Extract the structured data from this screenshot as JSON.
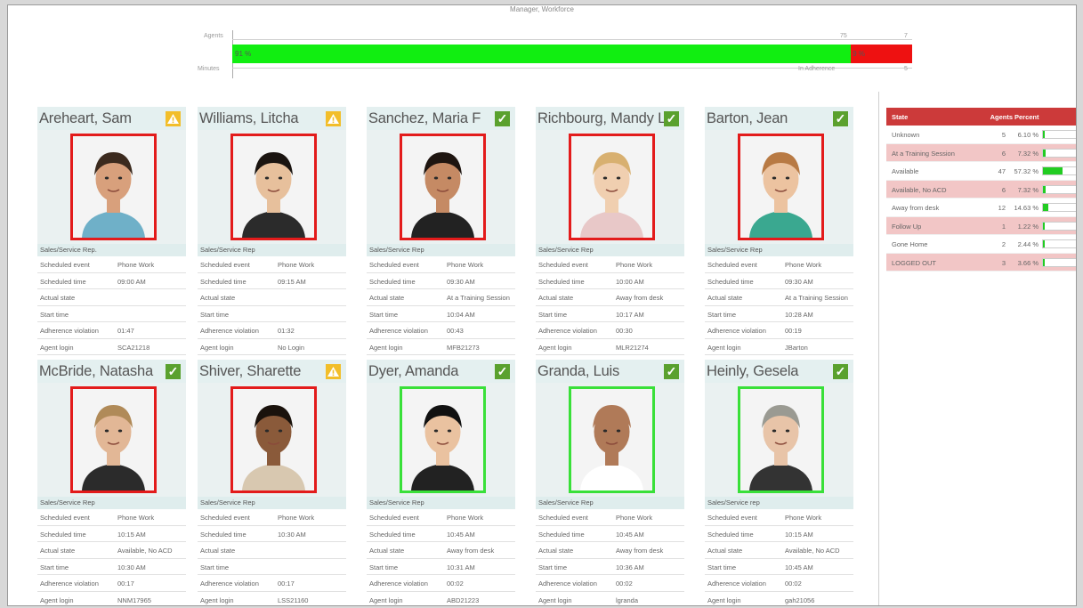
{
  "app": {
    "top_title": "Manager, Workforce"
  },
  "adherence": {
    "agents_label": "Agents",
    "minutes_label": "Minutes",
    "in_adherence_label": "In Adherence",
    "green_pct_label": "91 %",
    "red_pct_label": "9 %",
    "green_fraction": 0.91,
    "tick_75": "75",
    "tick_7": "7",
    "tick_5": "5"
  },
  "labels": {
    "scheduled_event": "Scheduled event",
    "scheduled_time": "Scheduled time",
    "actual_state": "Actual state",
    "start_time": "Start time",
    "adherence_violation": "Adherence violation",
    "agent_login": "Agent login"
  },
  "agents": [
    {
      "name": "Areheart, Sam",
      "status": "warning",
      "role": "Sales/Service Rep.",
      "scheduled_event": "Phone Work",
      "scheduled_time": "09:00 AM",
      "actual_state": "",
      "start_time": "",
      "adherence_violation": "01:47",
      "agent_login": "SCA21218",
      "frame": "red",
      "hair": "#3b2a1e",
      "skin": "#d8a07c",
      "shirt": "#6fb0c8"
    },
    {
      "name": "Williams, Litcha",
      "status": "warning",
      "role": "Sales/Service Rep",
      "scheduled_event": "Phone Work",
      "scheduled_time": "09:15 AM",
      "actual_state": "",
      "start_time": "",
      "adherence_violation": "01:32",
      "agent_login": "No Login",
      "frame": "red",
      "hair": "#1a1410",
      "skin": "#e7c09c",
      "shirt": "#2b2b2b"
    },
    {
      "name": "Sanchez, Maria F",
      "status": "ok",
      "role": "Sales/Service Rep",
      "scheduled_event": "Phone Work",
      "scheduled_time": "09:30 AM",
      "actual_state": "At a Training Session",
      "start_time": "10:04 AM",
      "adherence_violation": "00:43",
      "agent_login": "MFB21273",
      "frame": "red",
      "hair": "#1e1510",
      "skin": "#c58a64",
      "shirt": "#222222"
    },
    {
      "name": "Richbourg, Mandy L",
      "status": "ok",
      "role": "Sales/Service Rep",
      "scheduled_event": "Phone Work",
      "scheduled_time": "10:00 AM",
      "actual_state": "Away from desk",
      "start_time": "10:17 AM",
      "adherence_violation": "00:30",
      "agent_login": "MLR21274",
      "frame": "red",
      "hair": "#d8b070",
      "skin": "#f0cfb0",
      "shirt": "#e8c8c8"
    },
    {
      "name": "Barton, Jean",
      "status": "ok",
      "role": "Sales/Service Rep",
      "scheduled_event": "Phone Work",
      "scheduled_time": "09:30 AM",
      "actual_state": "At a Training Session",
      "start_time": "10:28 AM",
      "adherence_violation": "00:19",
      "agent_login": "JBarton",
      "frame": "red",
      "hair": "#b87a44",
      "skin": "#ecc3a0",
      "shirt": "#3aa890"
    },
    {
      "name": "McBride, Natasha",
      "status": "ok",
      "role": "Sales/Service Rep",
      "scheduled_event": "Phone Work",
      "scheduled_time": "10:15 AM",
      "actual_state": "Available, No ACD",
      "start_time": "10:30 AM",
      "adherence_violation": "00:17",
      "agent_login": "NNM17965",
      "frame": "red",
      "hair": "#b08a58",
      "skin": "#e2b796",
      "shirt": "#2b2b2b"
    },
    {
      "name": "Shiver, Sharette",
      "status": "warning",
      "role": "Sales/Service Rep",
      "scheduled_event": "Phone Work",
      "scheduled_time": "10:30 AM",
      "actual_state": "",
      "start_time": "",
      "adherence_violation": "00:17",
      "agent_login": "LSS21160",
      "frame": "red",
      "hair": "#1a120c",
      "skin": "#8a5a3a",
      "shirt": "#d8c8b0"
    },
    {
      "name": "Dyer, Amanda",
      "status": "ok",
      "role": "Sales/Service Rep",
      "scheduled_event": "Phone Work",
      "scheduled_time": "10:45 AM",
      "actual_state": "Away from desk",
      "start_time": "10:31 AM",
      "adherence_violation": "00:02",
      "agent_login": "ABD21223",
      "frame": "green",
      "hair": "#111111",
      "skin": "#eac2a0",
      "shirt": "#222222"
    },
    {
      "name": "Granda, Luis",
      "status": "ok",
      "role": "Sales/Service Rep",
      "scheduled_event": "Phone Work",
      "scheduled_time": "10:45 AM",
      "actual_state": "Away from desk",
      "start_time": "10:36 AM",
      "adherence_violation": "00:02",
      "agent_login": "lgranda",
      "frame": "green",
      "hair": "#b07a58",
      "skin": "#b07a58",
      "shirt": "#ffffff"
    },
    {
      "name": "Heinly, Gesela",
      "status": "ok",
      "role": "Sales/Service rep",
      "scheduled_event": "Phone Work",
      "scheduled_time": "10:15 AM",
      "actual_state": "Available, No ACD",
      "start_time": "10:45 AM",
      "adherence_violation": "00:02",
      "agent_login": "gah21056",
      "frame": "green",
      "hair": "#9a9a92",
      "skin": "#e8c4a8",
      "shirt": "#333333"
    }
  ],
  "state_table": {
    "headers": {
      "state": "State",
      "agents": "Agents",
      "percent": "Percent"
    },
    "rows": [
      {
        "state": "Unknown",
        "agents": "5",
        "percent": "6.10 %",
        "fraction": 0.061,
        "highlight": false
      },
      {
        "state": "At a Training Session",
        "agents": "6",
        "percent": "7.32 %",
        "fraction": 0.0732,
        "highlight": true
      },
      {
        "state": "Available",
        "agents": "47",
        "percent": "57.32 %",
        "fraction": 0.5732,
        "highlight": false
      },
      {
        "state": "Available, No ACD",
        "agents": "6",
        "percent": "7.32 %",
        "fraction": 0.0732,
        "highlight": true
      },
      {
        "state": "Away from desk",
        "agents": "12",
        "percent": "14.63 %",
        "fraction": 0.1463,
        "highlight": false
      },
      {
        "state": "Follow Up",
        "agents": "1",
        "percent": "1.22 %",
        "fraction": 0.0122,
        "highlight": true
      },
      {
        "state": "Gone Home",
        "agents": "2",
        "percent": "2.44 %",
        "fraction": 0.0244,
        "highlight": false
      },
      {
        "state": "LOGGED OUT",
        "agents": "3",
        "percent": "3.66 %",
        "fraction": 0.0366,
        "highlight": true
      }
    ]
  },
  "colors": {
    "alert_red": "#e31b1b",
    "adherence_green": "#11ee11",
    "ok_green": "#5aa12e",
    "warning_yellow": "#f2be2a",
    "header_red": "#cc3a3a"
  },
  "icons": {
    "ok": "check-icon",
    "warning": "warning-icon"
  }
}
